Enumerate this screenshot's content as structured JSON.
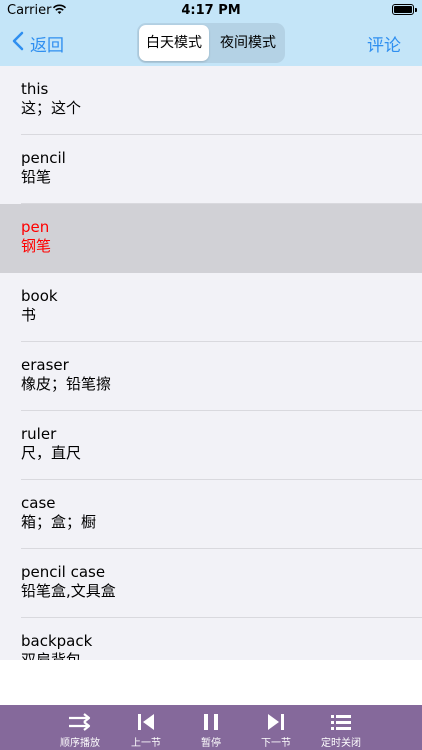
{
  "status_bar": {
    "carrier": "Carrier",
    "time": "4:17 PM"
  },
  "nav": {
    "back_label": "返回",
    "segments": [
      "白天模式",
      "夜间模式"
    ],
    "selected_segment": "白天模式",
    "comment_label": "评论"
  },
  "words": [
    {
      "en": "this",
      "zh": "这；这个"
    },
    {
      "en": "pencil",
      "zh": "铅笔"
    },
    {
      "en": "pen",
      "zh": "钢笔"
    },
    {
      "en": "book",
      "zh": "书"
    },
    {
      "en": "eraser",
      "zh": "橡皮；铅笔擦"
    },
    {
      "en": "ruler",
      "zh": "尺，直尺"
    },
    {
      "en": "case",
      "zh": "箱；盒；橱"
    },
    {
      "en": "pencil case",
      "zh": "铅笔盒,文具盒"
    },
    {
      "en": "backpack",
      "zh": "双肩背包"
    }
  ],
  "selected_word": "pen",
  "toolbar": {
    "order_play": "顺序播放",
    "prev": "上一节",
    "pause": "暂停",
    "next": "下一节",
    "timer": "定时关闭"
  },
  "colors": {
    "header_bg": "#c4e5f8",
    "accent": "#2f8ff0",
    "selected_text": "#ff0000",
    "toolbar_bg": "#85699b"
  }
}
